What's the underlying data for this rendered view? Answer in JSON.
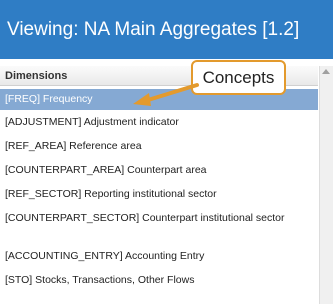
{
  "header": {
    "title": "Viewing: NA Main Aggregates [1.2]"
  },
  "dimensions": {
    "heading": "Dimensions",
    "items": [
      {
        "label": "[FREQ] Frequency",
        "selected": true
      },
      {
        "label": "[ADJUSTMENT] Adjustment indicator"
      },
      {
        "label": "[REF_AREA] Reference area"
      },
      {
        "label": "[COUNTERPART_AREA] Counterpart area"
      },
      {
        "label": "[REF_SECTOR] Reporting institutional sector"
      },
      {
        "label": "[COUNTERPART_SECTOR] Counterpart institutional sector"
      },
      {
        "label": "[ACCOUNTING_ENTRY] Accounting Entry"
      },
      {
        "label": "[STO] Stocks, Transactions, Other Flows"
      }
    ]
  },
  "callout": {
    "label": "Concepts"
  },
  "colors": {
    "header": "#2f7dc5",
    "selected": "#85a9d3",
    "callout_border": "#e39a2d"
  }
}
